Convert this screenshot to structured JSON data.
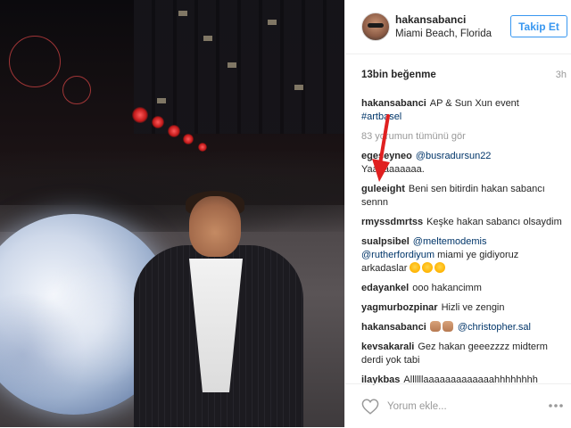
{
  "post": {
    "username": "hakansabanci",
    "location": "Miami Beach, Florida",
    "follow_label": "Takip Et",
    "likes": "13bin beğenme",
    "time": "3h",
    "caption_user": "hakansabanci",
    "caption_text": "AP & Sun Xun event",
    "caption_tag": "#artbasel",
    "view_all": "83 yorumun tümünü gör"
  },
  "comments": [
    {
      "user": "egeseyneo",
      "mention": "@busradursun22",
      "text": "Yaaaaaaaaaa."
    },
    {
      "user": "guleeight",
      "text": "Beni sen bitirdin hakan sabancı sennn"
    },
    {
      "user": "rmyssdmrtss",
      "text": "Keşke hakan sabancı olsaydim"
    },
    {
      "user": "sualpsibel",
      "mention": "@meltemodemis",
      "mention2": "@rutherfordiyum",
      "text": "miami ye gidiyoruz arkadaslar"
    },
    {
      "user": "edayankel",
      "text": "ooo hakancimm"
    },
    {
      "user": "yagmurbozpinar",
      "text": "Hizli ve zengin"
    },
    {
      "user": "hakansabanci",
      "mention": "@christopher.sal"
    },
    {
      "user": "kevsakarali",
      "text": "Gez hakan geeezzzz midterm derdi yok tabi"
    },
    {
      "user": "ilaykbas",
      "text": "Allllllaaaaaaaaaaaaahhhhhhhh"
    }
  ],
  "footer": {
    "comment_placeholder": "Yorum ekle..."
  },
  "colors": {
    "accent": "#3897f0",
    "tag": "#003569",
    "muted": "#999999",
    "annotation_arrow": "#e02020"
  },
  "icons": [
    "heart-icon",
    "more-options-icon",
    "annotation-arrow"
  ]
}
